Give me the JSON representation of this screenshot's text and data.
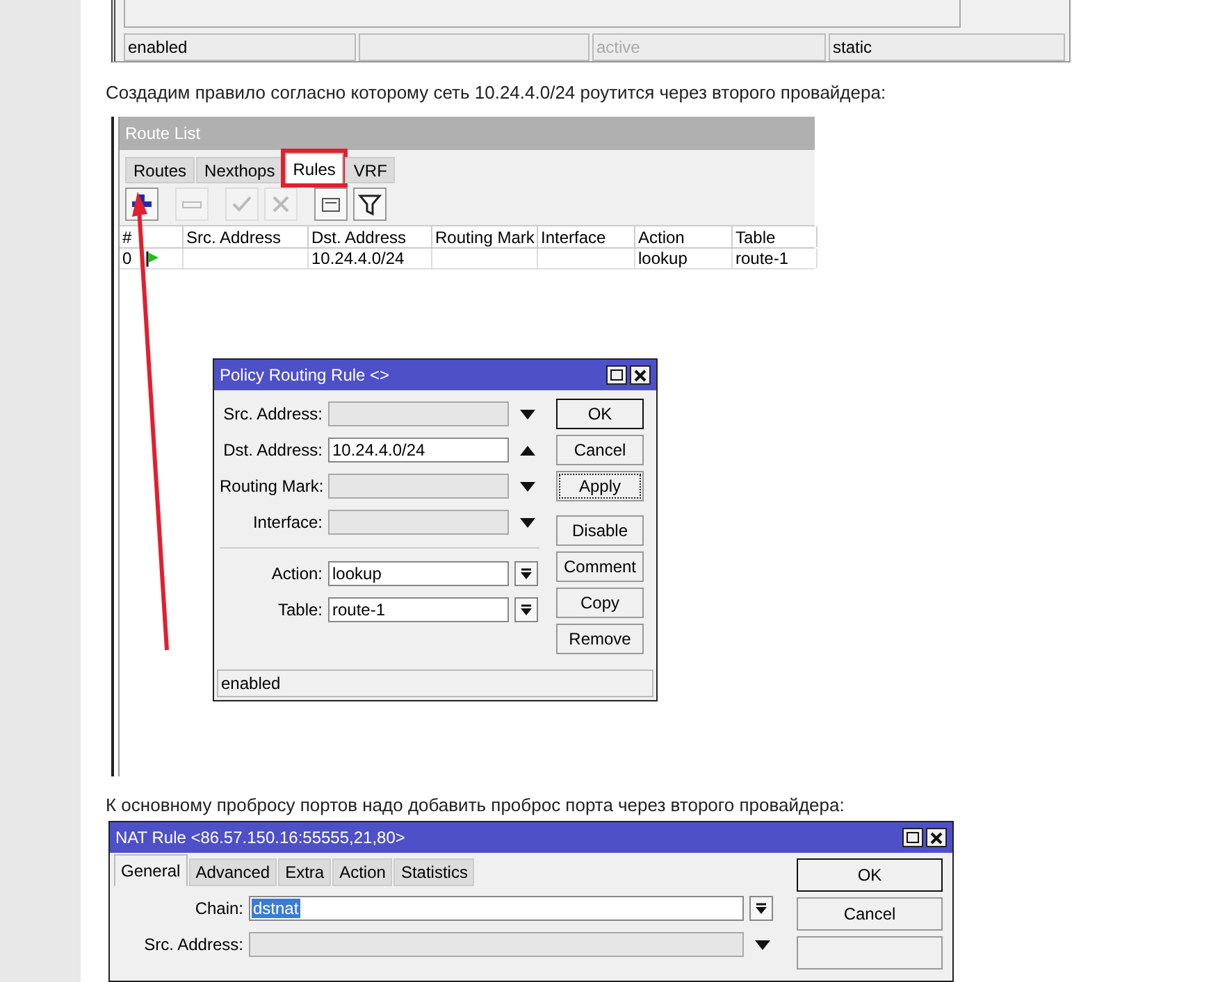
{
  "previous_window": {
    "status_bar": [
      {
        "kind": "text",
        "text": "enabled",
        "dimmed": false
      },
      {
        "kind": "empty"
      },
      {
        "kind": "text",
        "text": "active",
        "dimmed": true
      },
      {
        "kind": "text",
        "text": "static",
        "dimmed": false
      }
    ]
  },
  "paragraph_1": "Создадим правило согласно которому сеть 10.24.4.0/24 роутится через второго провайдера:",
  "route_list": {
    "title": "Route List",
    "tabs": [
      {
        "label": "Routes",
        "selected": false,
        "highlighted": false
      },
      {
        "label": "Nexthops",
        "selected": false,
        "highlighted": false
      },
      {
        "label": "Rules",
        "selected": true,
        "highlighted": true
      },
      {
        "label": "VRF",
        "selected": false,
        "highlighted": false
      }
    ],
    "toolbar": [
      {
        "kind": "add",
        "disabled": false
      },
      {
        "kind": "remove",
        "disabled": true
      },
      {
        "kind": "enable",
        "disabled": true
      },
      {
        "kind": "disable",
        "disabled": true
      },
      {
        "kind": "comment",
        "disabled": false
      },
      {
        "kind": "filter",
        "disabled": false
      }
    ],
    "columns": [
      "#",
      "Src. Address",
      "Dst. Address",
      "Routing Mark",
      "Interface",
      "Action",
      "Table"
    ],
    "rows": [
      {
        "number": "0",
        "dst_address": "10.24.4.0/24",
        "action": "lookup",
        "table": "route-1"
      }
    ]
  },
  "policy_routing_rule": {
    "title": "Policy Routing Rule <>",
    "fields": [
      {
        "kind": "optional",
        "label": "Src. Address:",
        "set": false
      },
      {
        "kind": "optional",
        "label": "Dst. Address:",
        "set": true,
        "value": "10.24.4.0/24"
      },
      {
        "kind": "optional",
        "label": "Routing Mark:",
        "set": false
      },
      {
        "kind": "optional",
        "label": "Interface:",
        "set": false
      },
      {
        "kind": "divider"
      },
      {
        "kind": "select",
        "label": "Action:",
        "value": "lookup"
      },
      {
        "kind": "select",
        "label": "Table:",
        "value": "route-1"
      }
    ],
    "buttons": [
      {
        "label": "OK",
        "focused": false
      },
      {
        "label": "Cancel",
        "focused": false
      },
      {
        "label": "Apply",
        "focused": true
      },
      {
        "label": "Disable",
        "focused": false
      },
      {
        "label": "Comment",
        "focused": false
      },
      {
        "label": "Copy",
        "focused": false
      },
      {
        "label": "Remove",
        "focused": false
      }
    ],
    "status": "enabled"
  },
  "paragraph_2": "К основному пробросу портов надо добавить проброс порта через второго провайдера:",
  "nat_rule": {
    "title": "NAT Rule <86.57.150.16:55555,21,80>",
    "tabs": [
      {
        "label": "General",
        "selected": true
      },
      {
        "label": "Advanced",
        "selected": false
      },
      {
        "label": "Extra",
        "selected": false
      },
      {
        "label": "Action",
        "selected": false
      },
      {
        "label": "Statistics",
        "selected": false
      }
    ],
    "fields": [
      {
        "kind": "select",
        "label": "Chain:",
        "value": "dstnat",
        "text_selected": true
      },
      {
        "kind": "optional",
        "label": "Src. Address:",
        "set": false
      }
    ],
    "buttons": [
      {
        "label": "OK"
      },
      {
        "label": "Cancel"
      }
    ]
  }
}
